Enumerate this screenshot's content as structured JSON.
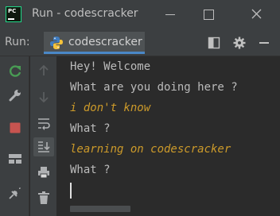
{
  "window": {
    "app_icon_text": "PC",
    "title": "Run - codescracker"
  },
  "toolbar": {
    "run_label": "Run:",
    "tab_label": "codescracker"
  },
  "console": {
    "lines": [
      {
        "text": "Hey! Welcome",
        "kind": "output"
      },
      {
        "text": "What are you doing here ?",
        "kind": "output"
      },
      {
        "text": "i don't know",
        "kind": "input"
      },
      {
        "text": "What ?",
        "kind": "output"
      },
      {
        "text": "learning on codescracker",
        "kind": "input"
      },
      {
        "text": "What ?",
        "kind": "output"
      }
    ]
  },
  "colors": {
    "output_text": "#bbbbbb",
    "input_text": "#cc9a2a",
    "accent": "#4a88c7",
    "rerun_green": "#499c54",
    "stop_red": "#c75450"
  },
  "icons": {
    "titlebar": [
      "pycharm-logo",
      "minimize-icon",
      "maximize-icon",
      "close-icon"
    ],
    "toolbar": [
      "python-icon",
      "layout-icon",
      "gear-icon",
      "minus-icon"
    ],
    "left_gutter": [
      "rerun-icon",
      "wrench-icon",
      "stop-icon",
      "layout-icon",
      "pin-icon"
    ],
    "console_gutter": [
      "arrow-up-icon",
      "arrow-down-icon",
      "soft-wrap-icon",
      "scroll-to-end-icon",
      "print-icon",
      "trash-icon"
    ]
  }
}
